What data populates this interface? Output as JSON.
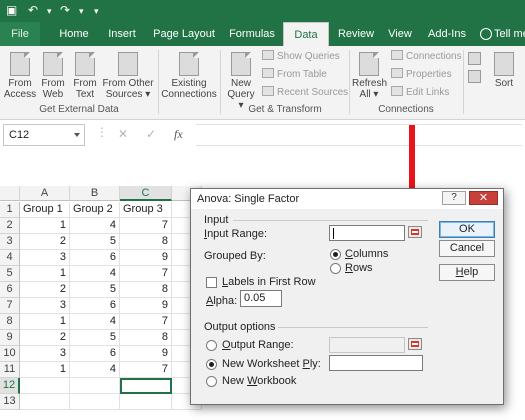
{
  "ribbon": {
    "tabs": [
      "File",
      "Home",
      "Insert",
      "Page Layout",
      "Formulas",
      "Data",
      "Review",
      "View",
      "Add-Ins"
    ],
    "active_tab": "Data",
    "tell_me": "Tell me",
    "get_external_data": {
      "label": "Get External Data",
      "buttons": [
        {
          "l1": "From",
          "l2": "Access"
        },
        {
          "l1": "From",
          "l2": "Web"
        },
        {
          "l1": "From",
          "l2": "Text"
        },
        {
          "l1": "From Other",
          "l2": "Sources ▾"
        },
        {
          "l1": "Existing",
          "l2": "Connections"
        }
      ]
    },
    "get_transform": {
      "label": "Get & Transform",
      "new_query": {
        "l1": "New",
        "l2": "Query ▾"
      },
      "show_queries": "Show Queries",
      "from_table": "From Table",
      "recent_sources": "Recent Sources"
    },
    "connections": {
      "label": "Connections",
      "refresh": {
        "l1": "Refresh",
        "l2": "All ▾"
      },
      "connections": "Connections",
      "properties": "Properties",
      "edit_links": "Edit Links"
    },
    "sort": "Sort"
  },
  "formula_bar": {
    "name_box": "C12",
    "cancel_symbol": "✕",
    "enter_symbol": "✓",
    "fx_symbol": "fx",
    "value": ""
  },
  "sheet": {
    "columns": [
      "A",
      "B",
      "C"
    ],
    "rows": [
      [
        "Group 1",
        "Group 2",
        "Group 3"
      ],
      [
        "1",
        "4",
        "7"
      ],
      [
        "2",
        "5",
        "8"
      ],
      [
        "3",
        "6",
        "9"
      ],
      [
        "1",
        "4",
        "7"
      ],
      [
        "2",
        "5",
        "8"
      ],
      [
        "3",
        "6",
        "9"
      ],
      [
        "1",
        "4",
        "7"
      ],
      [
        "2",
        "5",
        "8"
      ],
      [
        "3",
        "6",
        "9"
      ],
      [
        "1",
        "4",
        "7"
      ],
      [
        "",
        "",
        ""
      ],
      [
        "",
        "",
        ""
      ]
    ],
    "row_numbers": [
      "1",
      "2",
      "3",
      "4",
      "5",
      "6",
      "7",
      "8",
      "9",
      "10",
      "11",
      "12",
      "13"
    ],
    "active_cell": "C12"
  },
  "dialog": {
    "title": "Anova: Single Factor",
    "help_symbol": "?",
    "close_symbol": "✕",
    "input_section": "Input",
    "input_range_label": "Input Range:",
    "input_range_value": "",
    "grouped_by_label": "Grouped By:",
    "grouped_by_options": [
      "Columns",
      "Rows"
    ],
    "grouped_by_selected": "Columns",
    "labels_checkbox": "Labels in First Row",
    "labels_checked": false,
    "alpha_label": "Alpha:",
    "alpha_value": "0.05",
    "output_section": "Output options",
    "output_options": [
      "Output Range:",
      "New Worksheet Ply:",
      "New Workbook"
    ],
    "output_selected": "New Worksheet Ply:",
    "buttons": {
      "ok": "OK",
      "cancel": "Cancel",
      "help": "Help"
    }
  },
  "colors": {
    "excel_green": "#217346",
    "annotation_arrow": "#e8141b"
  }
}
